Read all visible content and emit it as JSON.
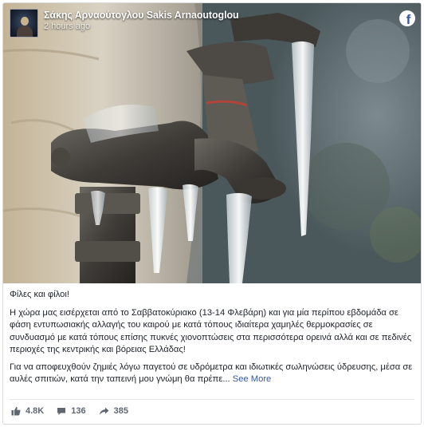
{
  "post": {
    "author": "Σάκης Αρναούτογλου Sakis Arnaoutoglou",
    "time": "2 hours ago",
    "greeting": "Φίλες και φίλοι!",
    "paragraph1": "Η χώρα μας εισέρχεται από το Σαββατοκύριακο (13-14 Φλεβάρη) και για μία περίπου εβδομάδα σε φάση εντυπωσιακής αλλαγής του καιρού με κατά τόπους ιδιαίτερα χαμηλές θερμοκρασίες σε συνδυασμό με κατά τόπους επίσης πυκνές χιονοπτώσεις στα περισσότερα ορεινά αλλά και σε πεδινές περιοχές της κεντρικής και βόρειας Ελλάδας!",
    "paragraph2": "Για να αποφευχθούν ζημιές λόγω παγετού σε υδρόμετρα και ιδιωτικές σωληνώσεις ύδρευσης, μέσα σε αυλές σπιτιών, κατά την ταπεινή μου γνώμη θα πρέπε...",
    "see_more": "See More"
  },
  "stats": {
    "likes": "4.8K",
    "comments": "136",
    "shares": "385"
  },
  "icons": {
    "platform": "facebook-icon",
    "like": "thumbs-up-icon",
    "comment": "comment-icon",
    "share": "share-icon"
  },
  "colors": {
    "link": "#385898",
    "text": "#1d2129",
    "muted": "#606770",
    "facebook": "#3b5998"
  }
}
